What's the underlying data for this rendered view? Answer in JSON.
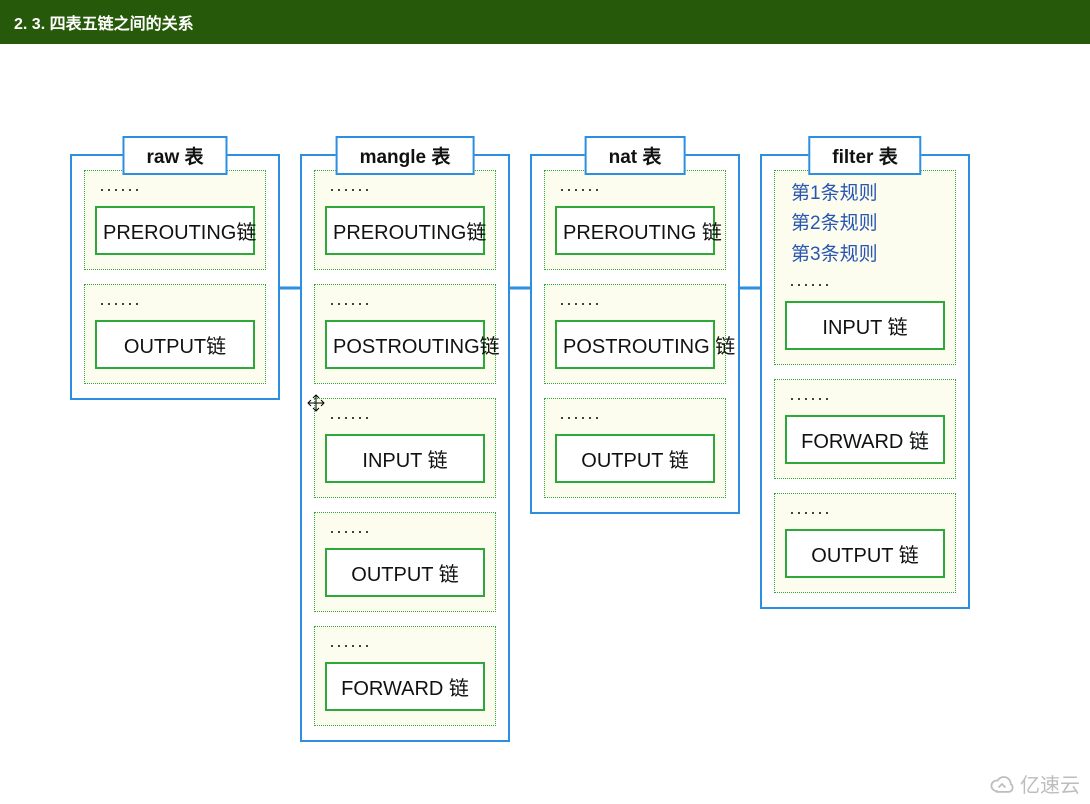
{
  "header": {
    "title": "2. 3.  四表五链之间的关系"
  },
  "dots": "······",
  "tables": {
    "raw": {
      "title": "raw 表",
      "chains": [
        "PREROUTING链",
        "OUTPUT链"
      ]
    },
    "mangle": {
      "title": "mangle 表",
      "chains": [
        "PREROUTING链",
        "POSTROUTING链",
        "INPUT 链",
        "OUTPUT 链",
        "FORWARD 链"
      ]
    },
    "nat": {
      "title": "nat 表",
      "chains": [
        "PREROUTING 链",
        "POSTROUTING 链",
        "OUTPUT 链"
      ]
    },
    "filter": {
      "title": "filter 表",
      "rules": [
        "第1条规则",
        "第2条规则",
        "第3条规则"
      ],
      "chains": [
        "INPUT 链",
        "FORWARD 链",
        "OUTPUT 链"
      ]
    }
  },
  "colors": {
    "arrow": "#2d8fe2",
    "tableBorder": "#2d8fe2",
    "chainBorder": "#2fa83a",
    "ruleText": "#2956b2"
  },
  "watermark": "亿速云"
}
